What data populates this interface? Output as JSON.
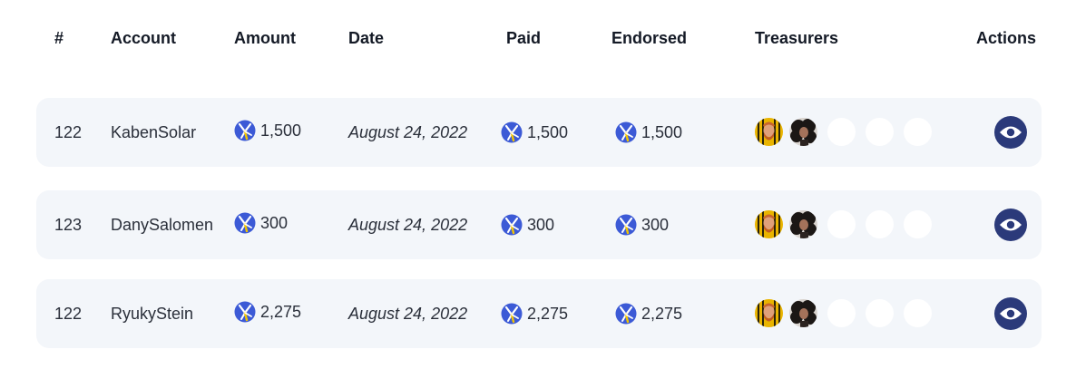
{
  "header": {
    "index": "#",
    "account": "Account",
    "amount": "Amount",
    "date": "Date",
    "paid": "Paid",
    "endorsed": "Endorsed",
    "treasurers": "Treasurers",
    "actions": "Actions"
  },
  "colors": {
    "row_background": "#f3f6fa",
    "action_button": "#2b3a7a",
    "token_blue": "#3c5ad6",
    "token_yellow": "#f2c500"
  },
  "icons": {
    "token": "token-logo-icon",
    "action": "eye-icon",
    "treasurer_1": "treasurer-avatar-bearded-man",
    "treasurer_2": "treasurer-avatar-curly-hair-woman",
    "empty_slot": "empty-treasurer-slot"
  },
  "rows": [
    {
      "index": "122",
      "account": "KabenSolar",
      "amount": "1,500",
      "date": "August 24, 2022",
      "paid": "1,500",
      "endorsed": "1,500",
      "treasurers_signed": 2,
      "treasurers_total": 5
    },
    {
      "index": "123",
      "account": "DanySalomen",
      "amount": "300",
      "date": "August 24, 2022",
      "paid": "300",
      "endorsed": "300",
      "treasurers_signed": 2,
      "treasurers_total": 5
    },
    {
      "index": "122",
      "account": "RyukyStein",
      "amount": "2,275",
      "date": "August 24, 2022",
      "paid": "2,275",
      "endorsed": "2,275",
      "treasurers_signed": 2,
      "treasurers_total": 5
    }
  ]
}
